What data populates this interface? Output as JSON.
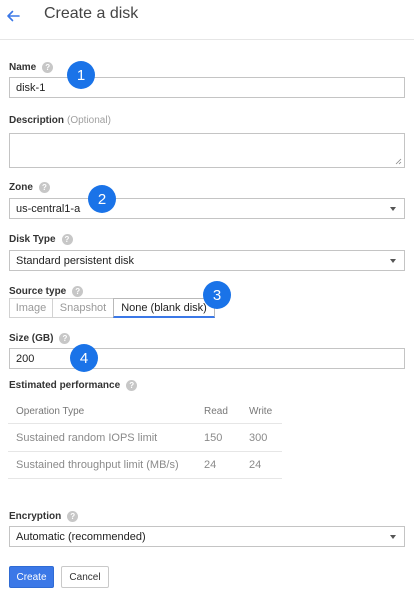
{
  "header": {
    "back_icon": "arrow-left-icon",
    "title": "Create a disk"
  },
  "fields": {
    "name": {
      "label": "Name",
      "value": "disk-1"
    },
    "description": {
      "label": "Description",
      "optional": "(Optional)",
      "value": ""
    },
    "zone": {
      "label": "Zone",
      "value": "us-central1-a"
    },
    "disk_type": {
      "label": "Disk Type",
      "value": "Standard persistent disk"
    },
    "source_type": {
      "label": "Source type",
      "options": [
        "Image",
        "Snapshot",
        "None (blank disk)"
      ],
      "selected": "None (blank disk)"
    },
    "size": {
      "label": "Size (GB)",
      "value": "200"
    },
    "encryption": {
      "label": "Encryption",
      "value": "Automatic (recommended)"
    }
  },
  "performance": {
    "label": "Estimated performance",
    "columns": [
      "Operation Type",
      "Read",
      "Write"
    ],
    "rows": [
      [
        "Sustained random IOPS limit",
        "150",
        "300"
      ],
      [
        "Sustained throughput limit (MB/s)",
        "24",
        "24"
      ]
    ]
  },
  "help_icon_glyph": "?",
  "badges": [
    "1",
    "2",
    "3",
    "4"
  ],
  "buttons": {
    "create": "Create",
    "cancel": "Cancel"
  },
  "colors": {
    "accent": "#3b78e7",
    "badge": "#1a73e8",
    "help_icon": "#c7c7c7"
  }
}
